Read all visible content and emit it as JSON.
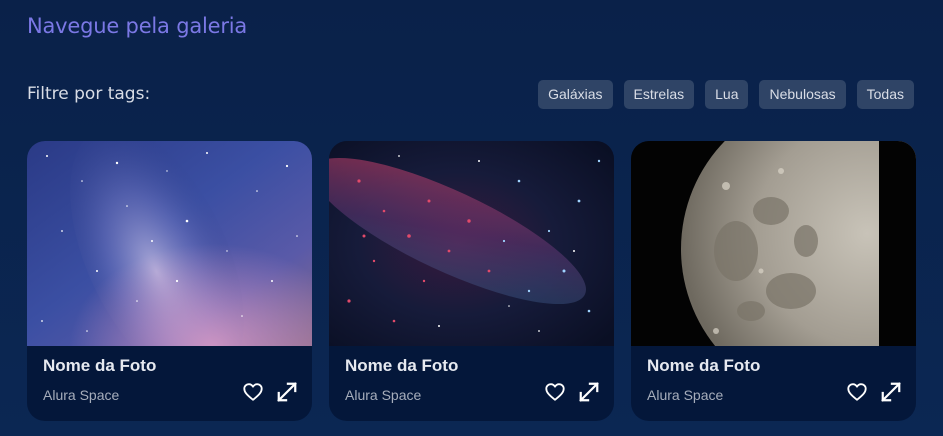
{
  "gallery": {
    "title": "Navegue pela galeria",
    "filter_label": "Filtre por tags:",
    "tags": [
      "Galáxias",
      "Estrelas",
      "Lua",
      "Nebulosas",
      "Todas"
    ]
  },
  "cards": [
    {
      "name": "Nome da Foto",
      "author": "Alura Space",
      "photo": "milky-way-sky"
    },
    {
      "name": "Nome da Foto",
      "author": "Alura Space",
      "photo": "red-blue-star-field"
    },
    {
      "name": "Nome da Foto",
      "author": "Alura Space",
      "photo": "moon"
    }
  ],
  "icons": {
    "favorite": "heart-icon",
    "expand": "expand-icon"
  },
  "colors": {
    "background": "#0a2149",
    "title": "#7b78e5",
    "tag_background": "#2f4466",
    "card_background": "#04173a"
  }
}
